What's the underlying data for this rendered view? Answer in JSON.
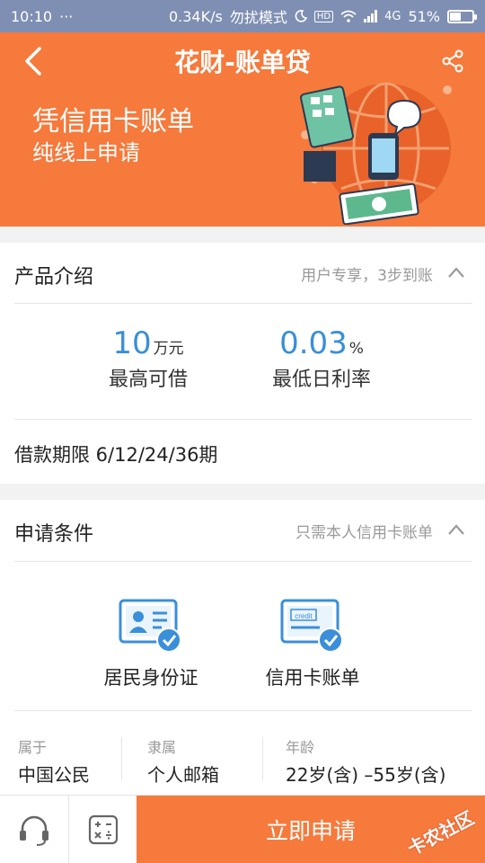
{
  "status_bar": {
    "time": "10:10",
    "dots": "···",
    "speed": "0.34K/s",
    "mode": "勿扰模式",
    "hd": "HD",
    "network": "4G",
    "battery_pct": "51%",
    "battery_level": 0.51
  },
  "header": {
    "title": "花财-账单贷",
    "banner_line1": "凭信用卡账单",
    "banner_line2": "纯线上申请"
  },
  "product": {
    "section_title": "产品介绍",
    "note": "用户专享，3步到账",
    "max_amount": {
      "value": "10",
      "unit": "万元",
      "label": "最高可借"
    },
    "min_rate": {
      "value": "0.03",
      "unit": "%",
      "label": "最低日利率"
    },
    "term": "借款期限 6/12/24/36期"
  },
  "conditions": {
    "section_title": "申请条件",
    "note": "只需本人信用卡账单",
    "items": [
      {
        "label": "居民身份证"
      },
      {
        "label": "信用卡账单",
        "card_text": "credit"
      }
    ],
    "info": [
      {
        "key": "属于",
        "value": "中国公民"
      },
      {
        "key": "隶属",
        "value": "个人邮箱"
      },
      {
        "key": "年龄",
        "value": "22岁(含) –55岁(含)"
      }
    ]
  },
  "bottom": {
    "apply_label": "立即申请",
    "watermark": "卡农社区"
  },
  "colors": {
    "accent": "#f57a3c",
    "blue": "#3a8fd8",
    "status_bar": "#7f8fb3"
  }
}
